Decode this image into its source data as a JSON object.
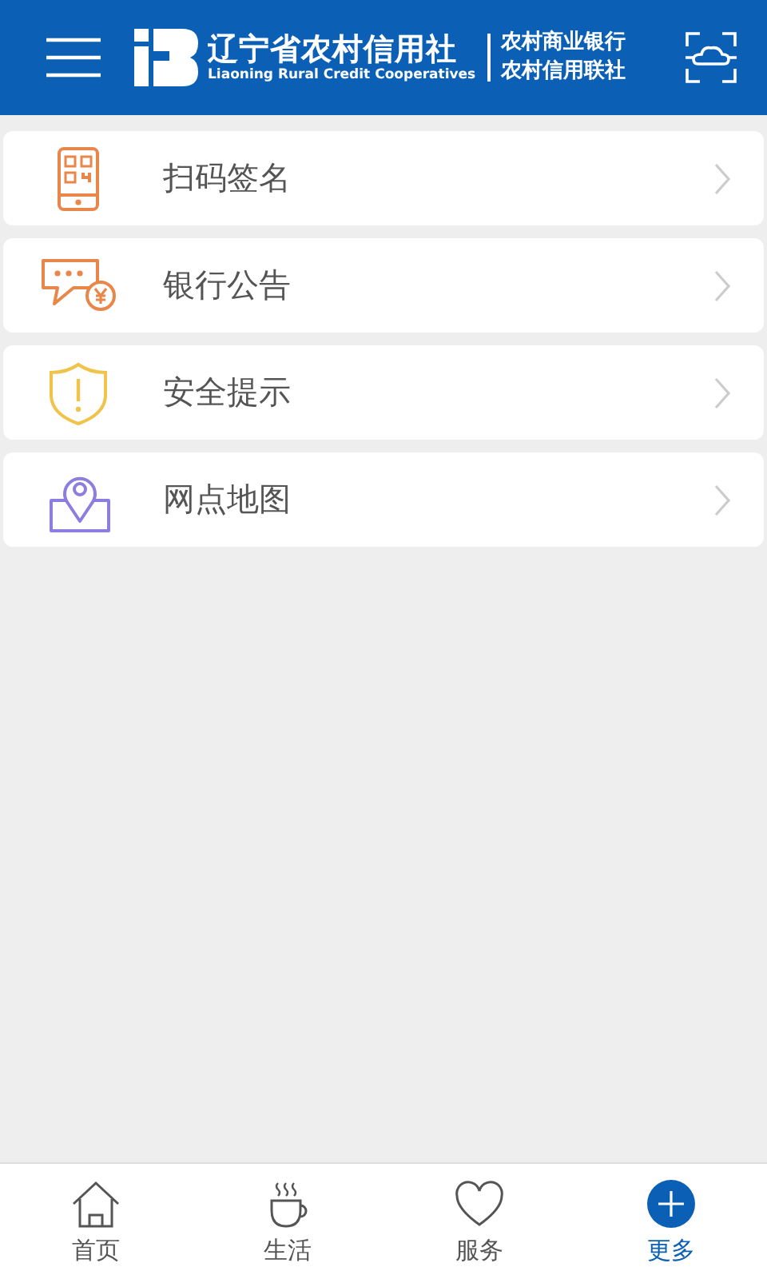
{
  "header": {
    "logo_title": "辽宁省农村信用社",
    "logo_subtitle": "Liaoning Rural Credit Cooperatives",
    "brand_lines": [
      "农村商业银行",
      "农村信用联社"
    ]
  },
  "menu_items": [
    {
      "label": "扫码签名",
      "kind": "qr"
    },
    {
      "label": "银行公告",
      "kind": "notice"
    },
    {
      "label": "安全提示",
      "kind": "shield"
    },
    {
      "label": "网点地图",
      "kind": "map"
    }
  ],
  "tabs": [
    {
      "label": "首页",
      "kind": "home",
      "selected": false
    },
    {
      "label": "生活",
      "kind": "cup",
      "selected": false
    },
    {
      "label": "服务",
      "kind": "heart",
      "selected": false
    },
    {
      "label": "更多",
      "kind": "plus",
      "selected": true
    }
  ]
}
